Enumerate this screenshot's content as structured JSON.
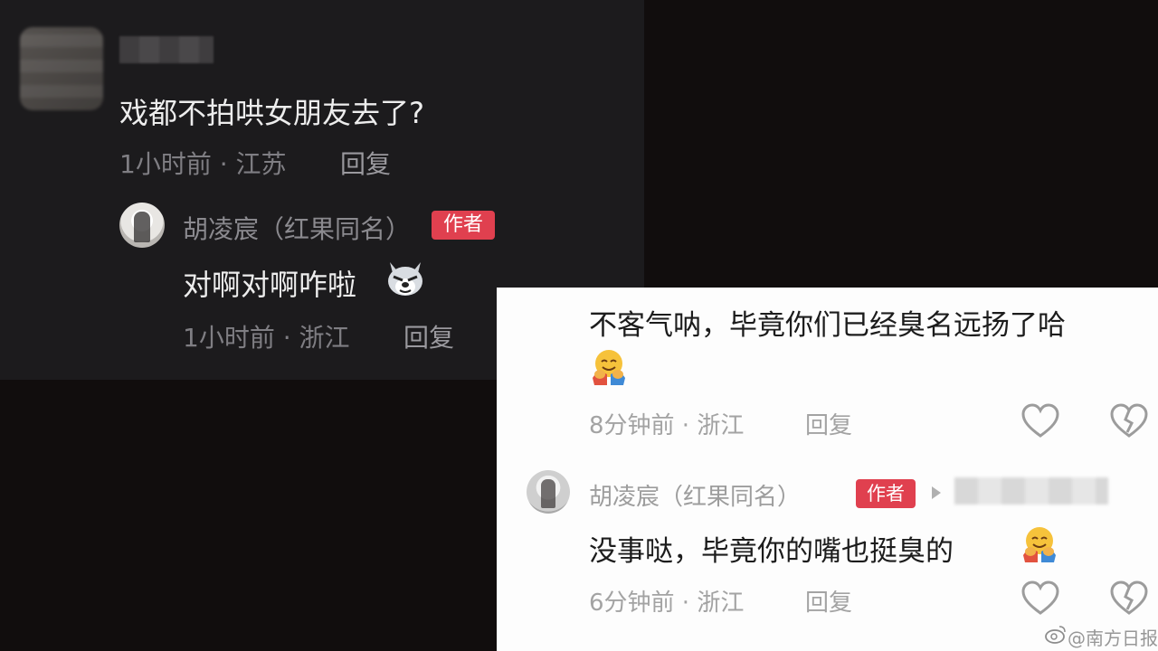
{
  "dark_thread": {
    "comment": {
      "text": "戏都不拍哄女朋友去了?",
      "meta": "1小时前 · 江苏",
      "reply": "回复"
    },
    "reply": {
      "username": "胡凌宸（红果同名）",
      "badge": "作者",
      "text": "对啊对啊咋啦",
      "emoji": "wolf-sticker-icon",
      "meta": "1小时前 · 浙江",
      "reply": "回复"
    }
  },
  "light_thread": {
    "comment": {
      "text": "不客气呐，毕竟你们已经臭名远扬了哈",
      "emoji": "hug-face-icon",
      "meta": "8分钟前 · 浙江",
      "reply": "回复"
    },
    "reply": {
      "username": "胡凌宸（红果同名）",
      "badge": "作者",
      "text": "没事哒，毕竟你的嘴也挺臭的",
      "emoji": "hug-face-icon",
      "meta": "6分钟前 · 浙江",
      "reply": "回复"
    }
  },
  "watermark": "@南方日报",
  "colors": {
    "dark_bg": "#1c1b1d",
    "page_bg": "#110d0d",
    "author_badge": "#e0404f",
    "light_bg": "#fdfdfd"
  }
}
